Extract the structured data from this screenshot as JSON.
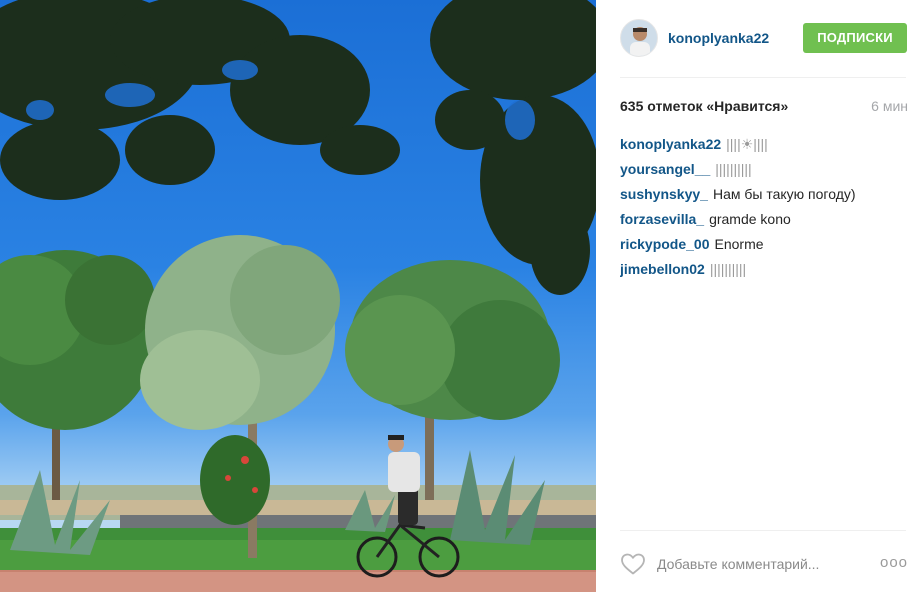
{
  "post": {
    "username": "konoplyanka22",
    "follow_label": "ПОДПИСКИ",
    "likes": "635 отметок «Нравится»",
    "time": "6 мин",
    "comments": [
      {
        "user": "konoplyanka22",
        "text": "||||☀||||"
      },
      {
        "user": "yoursangel__",
        "text": "||||||||||"
      },
      {
        "user": "sushynskyy_",
        "text": "Нам бы такую погоду)"
      },
      {
        "user": "forzasevilla_",
        "text": "gramde kono"
      },
      {
        "user": "rickypode_00",
        "text": "Enorme"
      },
      {
        "user": "jimebellon02",
        "text": "||||||||||"
      }
    ],
    "comment_placeholder": "Добавьте комментарий...",
    "more_label": "ooo"
  },
  "colors": {
    "link": "#125688",
    "follow": "#70c050",
    "muted": "#a5a7aa",
    "sky": "#2a82e3"
  },
  "icons": {
    "like": "heart-outline-icon",
    "more": "more-options-icon"
  }
}
